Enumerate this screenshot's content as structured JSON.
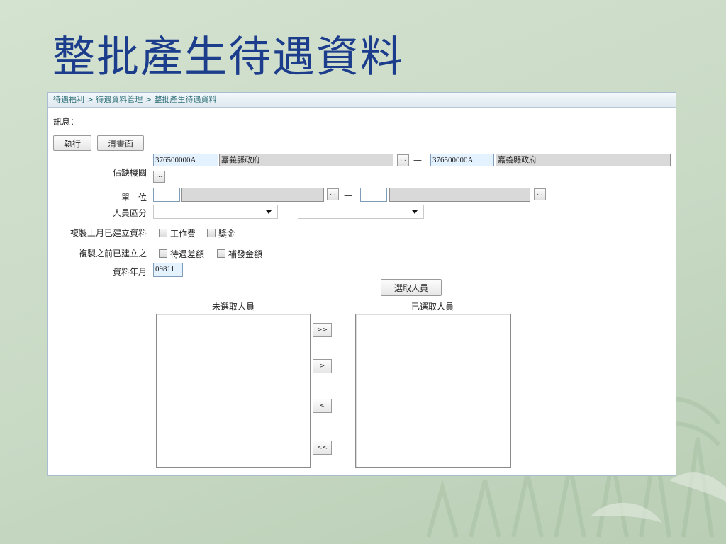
{
  "slide": {
    "title": "整批產生待遇資料"
  },
  "breadcrumb": "待遇福利 > 待遇資料管理 > 整批產生待遇資料",
  "message_label": "訊息：",
  "toolbar": {
    "execute": "執行",
    "clear": "清畫面"
  },
  "form": {
    "agency": {
      "label": "佔缺機關",
      "from_code": "376500000A",
      "from_name": "嘉義縣政府",
      "to_code": "376500000A",
      "to_name": "嘉義縣政府"
    },
    "unit": {
      "label": "單　位"
    },
    "personnel_type": {
      "label": "人員區分"
    },
    "copy_last_month": {
      "label": "複製上月已建立資料",
      "options": [
        "工作費",
        "獎金"
      ]
    },
    "copy_previous": {
      "label": "複製之前已建立之",
      "options": [
        "待遇差額",
        "補發金額"
      ]
    },
    "data_month": {
      "label": "資料年月",
      "value": "09811"
    },
    "dash": "—",
    "ellipsis": "..."
  },
  "selection": {
    "select_button": "選取人員",
    "unselected_title": "未選取人員",
    "selected_title": "已選取人員",
    "move_all_right": ">>",
    "move_right": ">",
    "move_left": "<",
    "move_all_left": "<<"
  }
}
